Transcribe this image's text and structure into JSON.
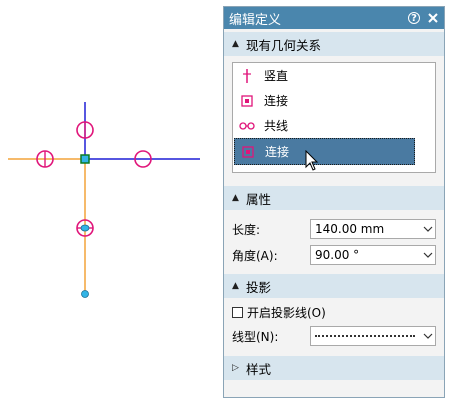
{
  "colors": {
    "titlebar": "#4a86ad",
    "section_header": "#d7e5ee",
    "selection": "#4a7aa1",
    "axis_blue": "#1f1fd6",
    "line_orange": "#f3a33a",
    "marker_magenta": "#e0157a",
    "node_cyan": "#32b4e6"
  },
  "panel": {
    "title": "编辑定义",
    "help_icon": "help-circle-icon",
    "close_icon": "close-x-icon",
    "sections": {
      "constraints": {
        "label": "现有几何关系",
        "expanded": true,
        "items": [
          {
            "label": "竖直",
            "icon": "vertical-constraint-icon"
          },
          {
            "label": "连接",
            "icon": "connect-constraint-icon"
          },
          {
            "label": "共线",
            "icon": "collinear-constraint-icon"
          },
          {
            "label": "连接",
            "icon": "connect-constraint-icon",
            "selected": true
          }
        ]
      },
      "properties": {
        "label": "属性",
        "expanded": true,
        "length_label": "长度:",
        "length_value": "140.00 mm",
        "angle_label": "角度(A):",
        "angle_value": "90.00 °"
      },
      "projection": {
        "label": "投影",
        "expanded": true,
        "checkbox_label": "开启投影线(O)",
        "checkbox_checked": false,
        "linetype_label": "线型(N):"
      },
      "style": {
        "label": "样式",
        "expanded": false
      }
    }
  }
}
